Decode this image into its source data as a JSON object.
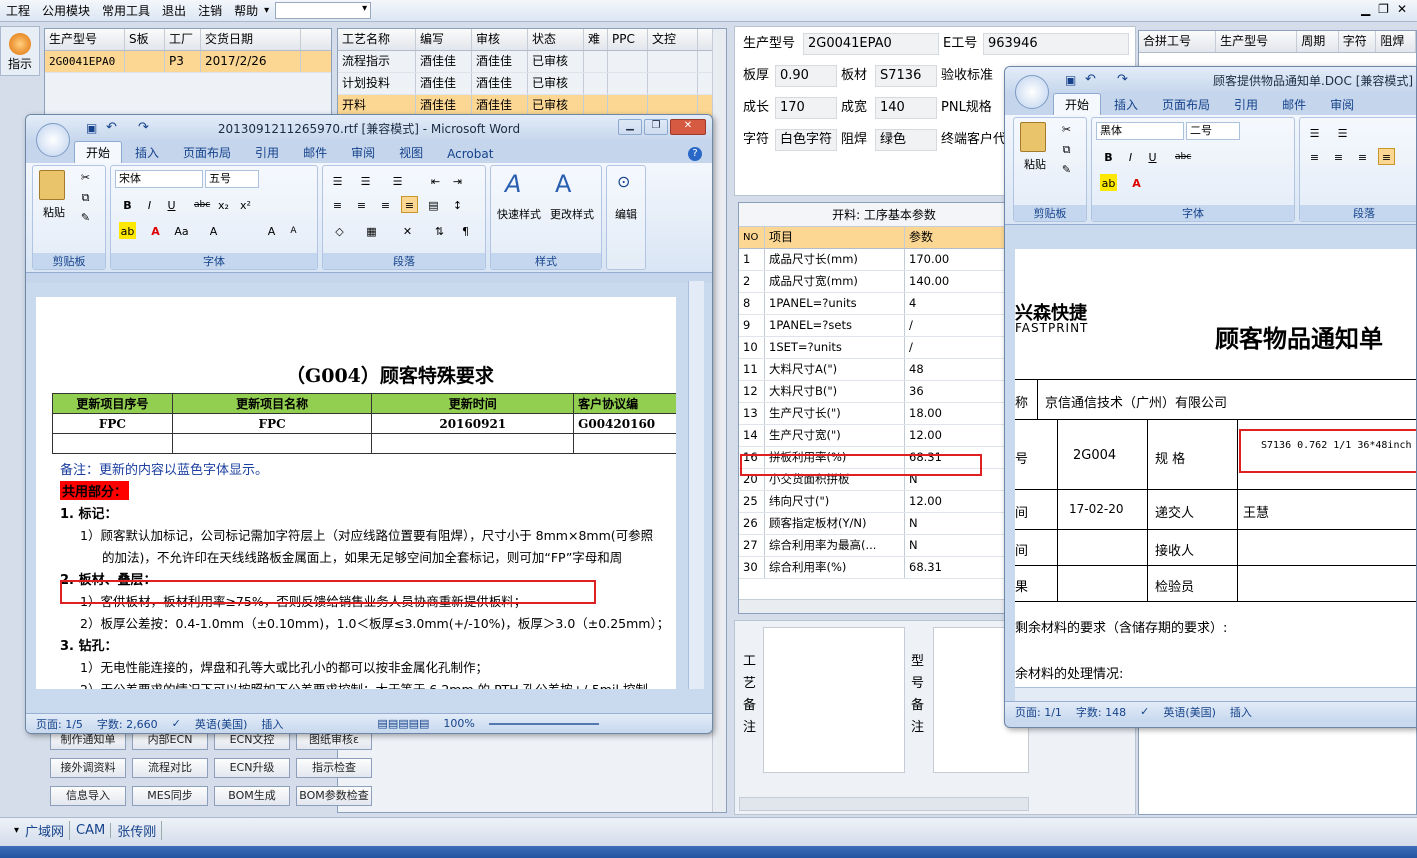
{
  "menubar": {
    "items": [
      "工程",
      "公用模块",
      "常用工具",
      "退出",
      "注销",
      "帮助"
    ]
  },
  "side": {
    "label": "指示"
  },
  "product_grid": {
    "headers": [
      "生产型号",
      "S板",
      "工厂",
      "交货日期"
    ],
    "row": [
      "2G0041EPA0",
      "",
      "P3",
      "2017/2/26"
    ]
  },
  "process_grid": {
    "headers": [
      "工艺名称",
      "编写",
      "审核",
      "状态",
      "难",
      "PPC",
      "文控"
    ],
    "rows": [
      [
        "流程指示",
        "酒佳佳",
        "酒佳佳",
        "已审核"
      ],
      [
        "计划投料",
        "酒佳佳",
        "酒佳佳",
        "已审核"
      ],
      [
        "开料",
        "酒佳佳",
        "酒佳佳",
        "已审核"
      ]
    ]
  },
  "buttons": [
    "制作通知单",
    "内部ECN",
    "ECN文控",
    "图纸审核ε",
    "接外调资料",
    "流程对比",
    "ECN升级",
    "指示检查",
    "信息导入",
    "MES同步",
    "BOM生成",
    "BOM参数检查"
  ],
  "bottom_tabs": [
    "广域网",
    "CAM",
    "张传刚"
  ],
  "info": {
    "model_label": "生产型号",
    "model": "2G0041EPA0",
    "eno_label": "E工号",
    "eno": "963946",
    "thick_label": "板厚",
    "thick": "0.90",
    "material_label": "板材",
    "material": "S7136",
    "accept_label": "验收标准",
    "len_label": "成长",
    "len": "170",
    "wid_label": "成宽",
    "wid": "140",
    "pnl_label": "PNL规格",
    "char_label": "字符",
    "char": "白色字符",
    "mask_label": "阻焊",
    "mask": "绿色",
    "final_label": "终端客户代"
  },
  "merge_grid": {
    "headers": [
      "合拼工号",
      "生产型号",
      "周期",
      "字符",
      "阻焊"
    ]
  },
  "params": {
    "title": "开料: 工序基本参数",
    "headers": [
      "NO",
      "项目",
      "参数"
    ],
    "rows": [
      [
        "1",
        "成品尺寸长(mm)",
        "170.00"
      ],
      [
        "2",
        "成品尺寸宽(mm)",
        "140.00"
      ],
      [
        "8",
        "1PANEL=?units",
        "4"
      ],
      [
        "9",
        "1PANEL=?sets",
        "/"
      ],
      [
        "10",
        "1SET=?units",
        "/"
      ],
      [
        "11",
        "大料尺寸A(\")",
        "48"
      ],
      [
        "12",
        "大料尺寸B(\")",
        "36"
      ],
      [
        "13",
        "生产尺寸长(\")",
        "18.00"
      ],
      [
        "14",
        "生产尺寸宽(\")",
        "12.00"
      ],
      [
        "16",
        "拼板利用率(%)",
        "68.31"
      ],
      [
        "20",
        "小交货面积拼板",
        "N"
      ],
      [
        "25",
        "纬向尺寸(\")",
        "12.00"
      ],
      [
        "26",
        "顾客指定板材(Y/N)",
        "N"
      ],
      [
        "27",
        "综合利用率为最高(...",
        "N"
      ],
      [
        "30",
        "综合利用率(%)",
        "68.31"
      ]
    ]
  },
  "remark": {
    "proc": "工艺备注",
    "model": "型号备注"
  },
  "word1": {
    "title": "2013091211265970.rtf [兼容模式] - Microsoft Word",
    "tabs": [
      "开始",
      "插入",
      "页面布局",
      "引用",
      "邮件",
      "审阅",
      "视图",
      "Acrobat"
    ],
    "ribbon": {
      "paste": "粘贴",
      "clipboard": "剪贴板",
      "font_name": "宋体",
      "font_size": "五号",
      "font": "字体",
      "para": "段落",
      "style_quick": "快速样式",
      "style_change": "更改样式",
      "styles": "样式",
      "edit": "编辑"
    },
    "doc": {
      "heading": "（G004）顾客特殊要求",
      "table_headers": [
        "更新项目序号",
        "更新项目名称",
        "更新时间",
        "客户协议编"
      ],
      "table_row": [
        "FPC",
        "FPC",
        "20160921",
        "G00420160"
      ],
      "note": "备注：更新的内容以蓝色字体显示。",
      "common": "共用部分：",
      "s1": "1.   标记：",
      "l1": "1）顾客默认加标记，公司标记需加字符层上（对应线路位置要有阻焊），尺寸小于 8mm×8mm(可参照",
      "l2": "的加法)，不允许印在天线线路板金属面上，如果无足够空间加全套标记，则可加“FP”字母和周",
      "s2": "2.   板材、叠层：",
      "l3": "1）客供板材，板材利用率≥75%，否则反馈给销售业务人员协商重新提供板料；",
      "l4": "2）板厚公差按：0.4-1.0mm（±0.10mm)，1.0＜板厚≤3.0mm(+/-10%)，板厚＞3.0（±0.25mm）；",
      "s3": "3.   钻孔：",
      "l5": "1）无电性能连接的，焊盘和孔等大或比孔小的都可以按非金属化孔制作；",
      "l6": "2）无公差要求的情况下可以按照如下公差要求控制：大于等于 6.2mm 的 PTH 孔公差按+/-5mil 控制"
    },
    "status": {
      "page": "页面: 1/5",
      "words": "字数: 2,660",
      "lang": "英语(美国)",
      "mode": "插入",
      "zoom": "100%"
    }
  },
  "word2": {
    "title": "顾客提供物品通知单.DOC [兼容模式]",
    "tabs": [
      "开始",
      "插入",
      "页面布局",
      "引用",
      "邮件",
      "审阅"
    ],
    "ribbon": {
      "paste": "粘贴",
      "clipboard": "剪贴板",
      "font_name": "黑体",
      "font_size": "二号",
      "font": "字体",
      "para": "段落"
    },
    "doc": {
      "logo_cn": "兴森快捷",
      "logo_en": "FASTPRINT",
      "heading": "顾客物品通知单",
      "rows": [
        [
          "称",
          "京信通信技术（广州）有限公司"
        ],
        [
          "号",
          "2G004",
          "规 格",
          "S7136 0.762 1/1 36*48inch"
        ],
        [
          "间",
          "17-02-20",
          "递交人",
          "王慧"
        ],
        [
          "间",
          "",
          "接收人",
          ""
        ],
        [
          "果",
          "",
          "检验员",
          ""
        ]
      ],
      "l1": "剩余材料的要求（含储存期的要求）:",
      "l2": "余材料的处理情况:"
    },
    "status": {
      "page": "页面: 1/1",
      "words": "字数: 148",
      "lang": "英语(美国)",
      "mode": "插入"
    }
  }
}
